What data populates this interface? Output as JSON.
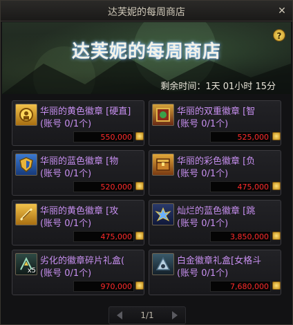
{
  "window": {
    "title": "达芙妮的每周商店",
    "close_glyph": "✕"
  },
  "banner": {
    "heading": "达芙妮的每周商店",
    "help_glyph": "?",
    "time_label": "剩余时间：1天 01小时 15分"
  },
  "items": [
    {
      "name": "华丽的黄色徽章 [硬直]",
      "limit": "(账号 0/1个)",
      "price": "550,000",
      "icon": "yellow-emblem-icon",
      "color": "#e0a52a"
    },
    {
      "name": "华丽的双重徽章 [智",
      "limit": "(账号 0/1个)",
      "price": "525,000",
      "icon": "dual-emblem-icon",
      "color": "#b0462a"
    },
    {
      "name": "华丽的蓝色徽章 [物",
      "limit": "(账号 0/1个)",
      "price": "520,000",
      "icon": "blue-emblem-icon",
      "color": "#2a62b8"
    },
    {
      "name": "华丽的彩色徽章 [负",
      "limit": "(账号 0/1个)",
      "price": "475,000",
      "icon": "rainbow-emblem-icon",
      "color": "#c9862a"
    },
    {
      "name": "华丽的黄色徽章 [攻",
      "limit": "(账号 0/1个)",
      "price": "475,000",
      "icon": "yellow-emblem-icon",
      "color": "#e0a52a"
    },
    {
      "name": "灿烂的蓝色徽章 [跳",
      "limit": "(账号 0/1个)",
      "price": "3,850,000",
      "icon": "brilliant-blue-emblem-icon",
      "color": "#3a5fc8"
    },
    {
      "name": "劣化的徽章碎片礼盒(",
      "limit": "(账号 0/1个)",
      "price": "970,000",
      "icon": "emblem-fragment-box-icon",
      "color": "#3a6a5a",
      "badge": "x5"
    },
    {
      "name": "白金徽章礼盒[女格斗",
      "limit": "(账号 0/1个)",
      "price": "7,680,000",
      "icon": "platinum-emblem-box-icon",
      "color": "#5c8aa8"
    }
  ],
  "pager": {
    "page": "1/1"
  }
}
